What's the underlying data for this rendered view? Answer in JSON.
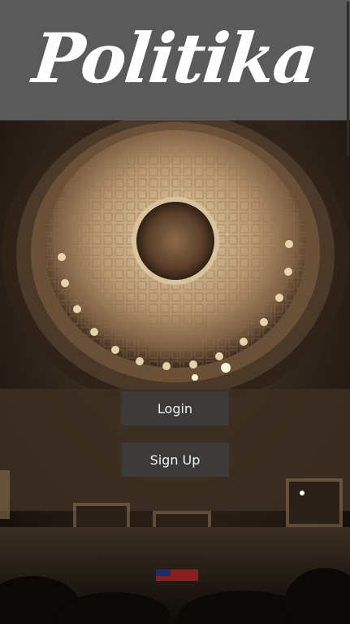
{
  "app": {
    "logo_text": "Politika"
  },
  "hero": {
    "image_name": "capitol-rotunda-photo"
  },
  "actions": {
    "login_label": "Login",
    "signup_label": "Sign Up"
  },
  "colors": {
    "header_bg": "#5a5a5a",
    "button_bg": "#3c3c3c",
    "text": "#ffffff"
  }
}
